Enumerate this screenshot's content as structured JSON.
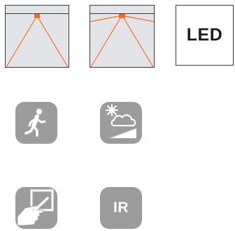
{
  "led_label": "LED",
  "ir_label": "IR",
  "colors": {
    "accent": "#ff6a1a",
    "icon_gray": "#9c9c9c",
    "panel_gray": "#e3e4e8",
    "outline": "#3a3a3a"
  },
  "icons": [
    "ceiling-sensor-detection-diagram",
    "wall-sensor-detection-diagram",
    "motion-walking-icon",
    "daylight-sun-cloud-icon",
    "touch-screen-hand-icon",
    "ir-icon"
  ]
}
